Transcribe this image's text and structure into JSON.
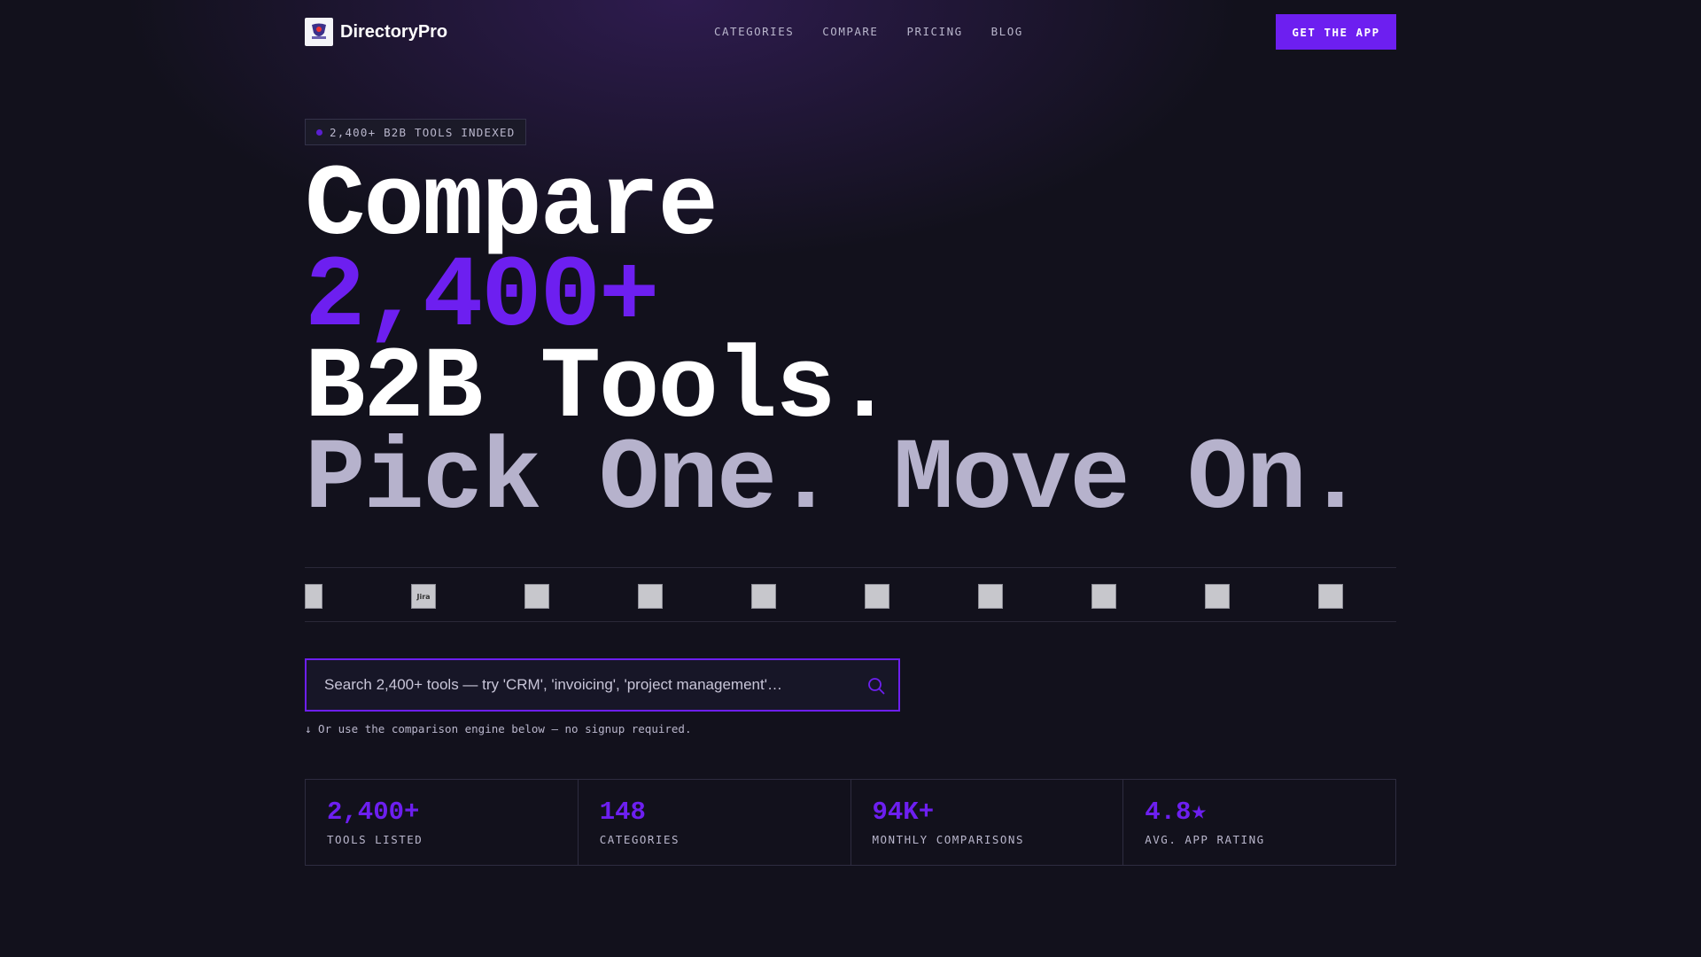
{
  "brand": {
    "name": "DirectoryPro"
  },
  "nav": {
    "items": [
      "CATEGORIES",
      "COMPARE",
      "PRICING",
      "BLOG"
    ]
  },
  "cta": {
    "label": "GET THE APP"
  },
  "badge": {
    "text": "2,400+ B2B TOOLS INDEXED"
  },
  "headline": {
    "line1": "Compare",
    "line2": "2,400+",
    "line3": "B2B Tools.",
    "line4": "Pick One. Move On."
  },
  "logos": [
    {
      "name": "",
      "text": ""
    },
    {
      "name": "jira",
      "text": "Jira"
    },
    {
      "name": "",
      "text": ""
    },
    {
      "name": "",
      "text": ""
    },
    {
      "name": "",
      "text": ""
    },
    {
      "name": "",
      "text": ""
    },
    {
      "name": "",
      "text": ""
    },
    {
      "name": "",
      "text": ""
    },
    {
      "name": "",
      "text": ""
    },
    {
      "name": "",
      "text": ""
    }
  ],
  "search": {
    "placeholder": "Search 2,400+ tools — try 'CRM', 'invoicing', 'project management'…",
    "hint": "↓ Or use the comparison engine below — no signup required."
  },
  "stats": [
    {
      "value": "2,400+",
      "label": "TOOLS LISTED"
    },
    {
      "value": "148",
      "label": "CATEGORIES"
    },
    {
      "value": "94K+",
      "label": "MONTHLY COMPARISONS"
    },
    {
      "value": "4.8★",
      "label": "AVG. APP RATING"
    }
  ],
  "colors": {
    "accent": "#6d1ff0",
    "background": "#12111c",
    "muted": "#b6b2cc"
  }
}
